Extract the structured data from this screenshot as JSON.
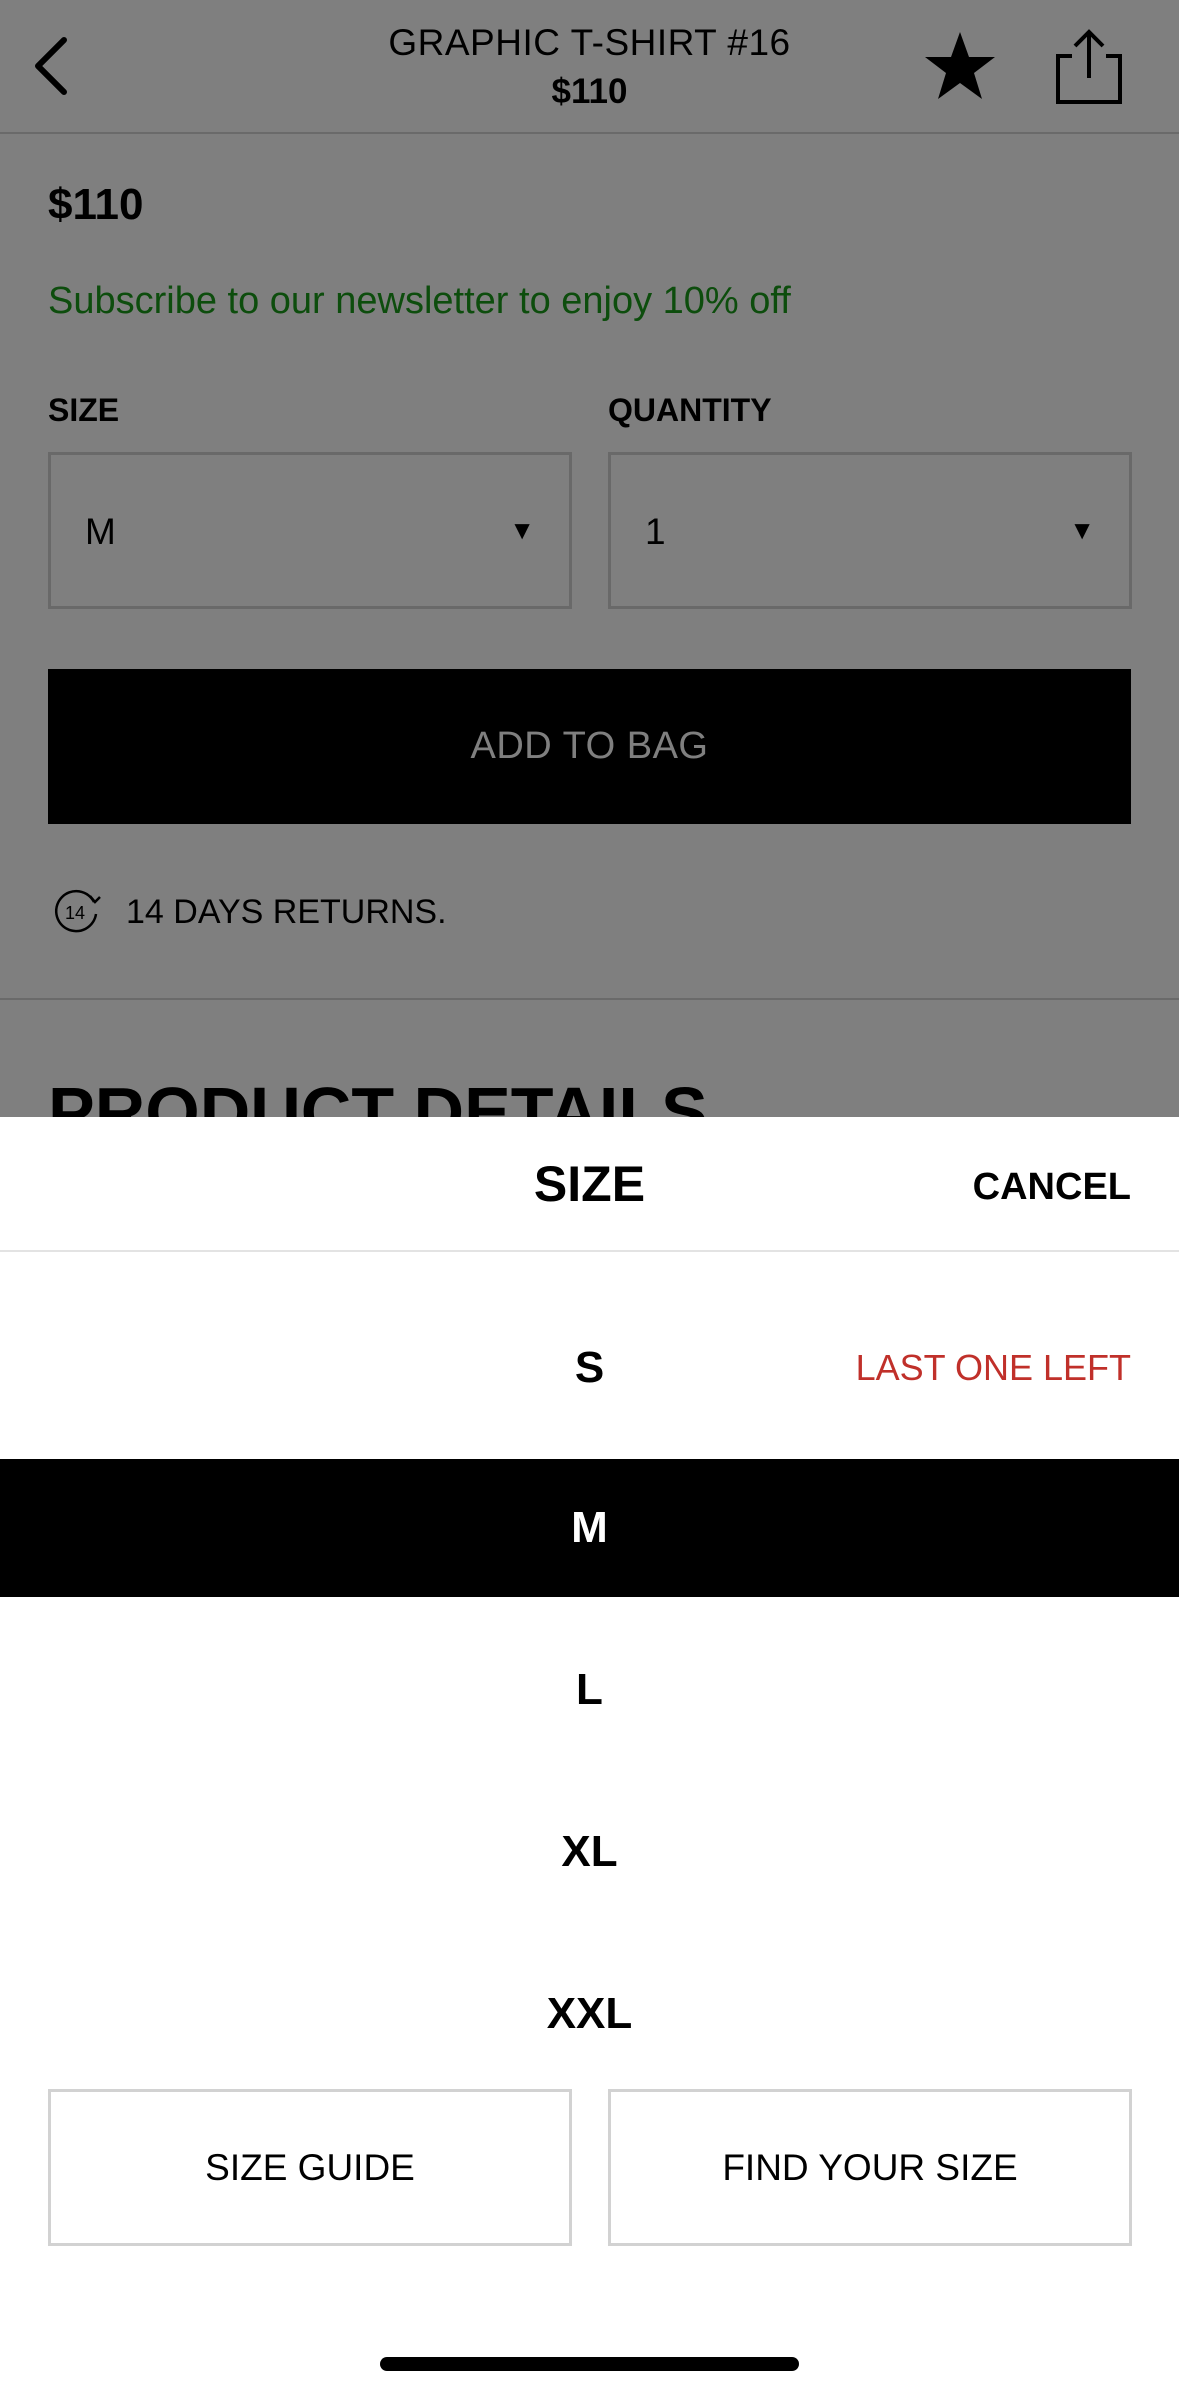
{
  "header": {
    "title": "GRAPHIC T-SHIRT #16",
    "price": "$110",
    "back_icon": "chevron-left-icon",
    "favorite_icon": "star-icon",
    "share_icon": "share-icon"
  },
  "product": {
    "price": "$110",
    "promo": "Subscribe to our newsletter to enjoy 10% off",
    "promo_color": "#1a9a1a",
    "size": {
      "label": "SIZE",
      "value": "M"
    },
    "quantity": {
      "label": "QUANTITY",
      "value": "1"
    },
    "add_to_bag": "ADD TO BAG",
    "returns": "14 DAYS RETURNS.",
    "returns_icon_label": "14",
    "section_title": "PRODUCT DETAILS"
  },
  "size_sheet": {
    "title": "SIZE",
    "cancel": "CANCEL",
    "options": [
      {
        "label": "S",
        "note": "LAST ONE LEFT",
        "selected": false
      },
      {
        "label": "M",
        "note": "",
        "selected": true
      },
      {
        "label": "L",
        "note": "",
        "selected": false
      },
      {
        "label": "XL",
        "note": "",
        "selected": false
      },
      {
        "label": "XXL",
        "note": "",
        "selected": false
      }
    ],
    "note_color": "#c0302a",
    "size_guide": "SIZE GUIDE",
    "find_your_size": "FIND YOUR SIZE"
  }
}
